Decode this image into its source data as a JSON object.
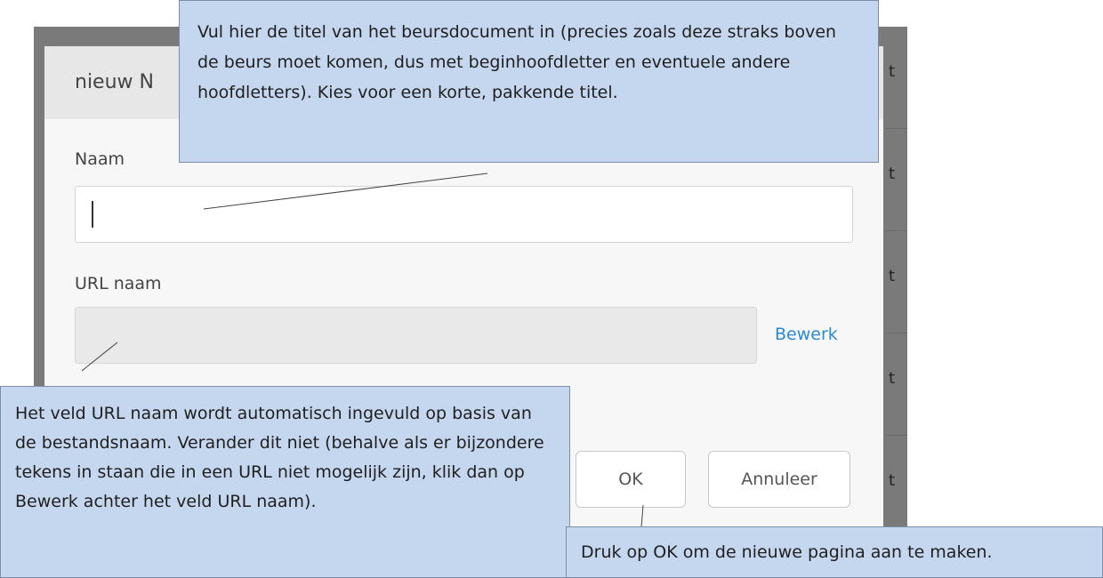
{
  "background_rows": [
    "t",
    "t",
    "t",
    "t",
    "t"
  ],
  "dialog": {
    "title": "nieuw N",
    "name_label": "Naam",
    "name_value": "",
    "url_label": "URL naam",
    "url_value": "",
    "edit_link": "Bewerk",
    "ok_label": "OK",
    "cancel_label": "Annuleer"
  },
  "callouts": {
    "title_help": "Vul hier de titel van het beursdocument in (precies zoals deze straks boven de beurs moet komen, dus met beginhoofdletter en eventuele andere hoofdletters). Kies voor een korte, pakkende titel.",
    "url_help": "Het veld URL naam wordt automatisch ingevuld op basis van de bestandsnaam. Verander dit niet (behalve als er bijzondere tekens in staan die in een URL niet mogelijk zijn, klik dan op Bewerk achter het veld URL naam).",
    "ok_help": "Druk op OK om de nieuwe pagina aan te maken."
  },
  "colors": {
    "callout_fill": "#c5d7ef",
    "link": "#2a8ad6",
    "backdrop": "#7a7a7a"
  }
}
